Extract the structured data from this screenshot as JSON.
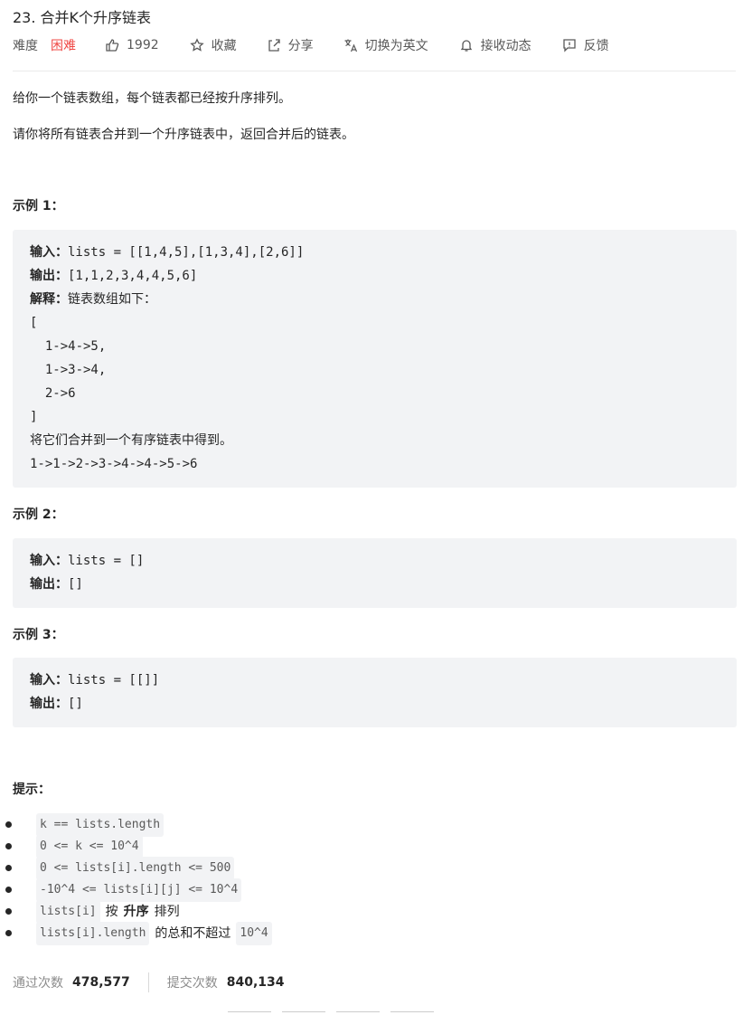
{
  "title": "23. 合并K个升序链表",
  "meta": {
    "difficulty_label": "难度",
    "difficulty_value": "困难",
    "likes": "1992",
    "favorite": "收藏",
    "share": "分享",
    "translate": "切换为英文",
    "notify": "接收动态",
    "feedback": "反馈"
  },
  "description": {
    "p1": "给你一个链表数组，每个链表都已经按升序排列。",
    "p2": "请你将所有链表合并到一个升序链表中，返回合并后的链表。"
  },
  "labels": {
    "input": "输入：",
    "output": "输出：",
    "explain": "解释："
  },
  "examples": [
    {
      "heading": "示例 1：",
      "input": "lists = [[1,4,5],[1,3,4],[2,6]]",
      "output": "[1,1,2,3,4,4,5,6]",
      "explanation": "链表数组如下：",
      "lines": [
        "[",
        "  1->4->5,",
        "  1->3->4,",
        "  2->6",
        "]"
      ],
      "note": "将它们合并到一个有序链表中得到。",
      "result": "1->1->2->3->4->4->5->6"
    },
    {
      "heading": "示例 2：",
      "input": "lists = []",
      "output": "[]"
    },
    {
      "heading": "示例 3：",
      "input": "lists = [[]]",
      "output": "[]"
    }
  ],
  "hints": {
    "heading": "提示：",
    "items": [
      {
        "code": "k == lists.length"
      },
      {
        "code": "0 <= k <= 10^4"
      },
      {
        "code": "0 <= lists[i].length <= 500"
      },
      {
        "code": "-10^4 <= lists[i][j] <= 10^4"
      },
      {
        "code": "lists[i]",
        "text1": "按",
        "strong": "升序",
        "text2": "排列"
      },
      {
        "code": "lists[i].length",
        "text1": "的总和不超过",
        "code2": "10^4"
      }
    ]
  },
  "stats": {
    "accepted_label": "通过次数",
    "accepted_value": "478,577",
    "submitted_label": "提交次数",
    "submitted_value": "840,134"
  },
  "colors": {
    "hard": "#ef4743",
    "code_bg": "#f2f3f5"
  }
}
